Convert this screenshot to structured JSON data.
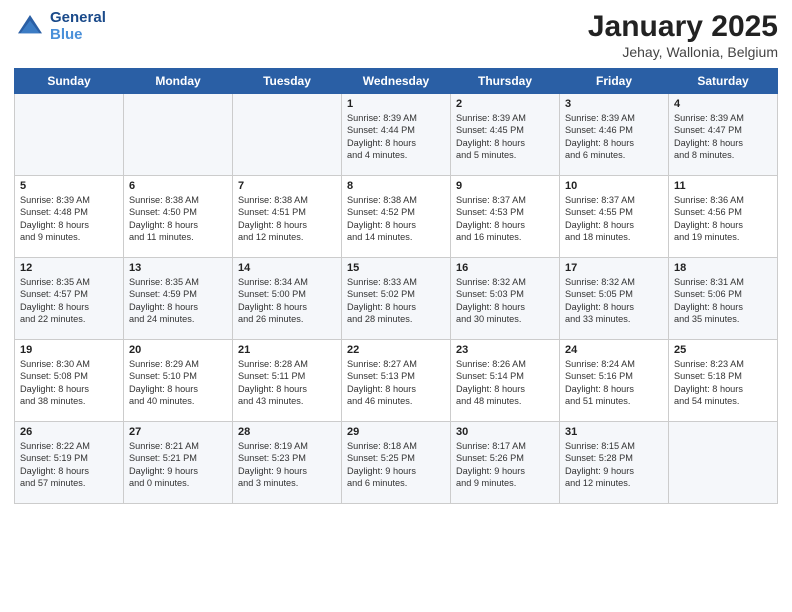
{
  "header": {
    "logo_line1": "General",
    "logo_line2": "Blue",
    "title": "January 2025",
    "subtitle": "Jehay, Wallonia, Belgium"
  },
  "days_of_week": [
    "Sunday",
    "Monday",
    "Tuesday",
    "Wednesday",
    "Thursday",
    "Friday",
    "Saturday"
  ],
  "weeks": [
    [
      {
        "day": "",
        "content": ""
      },
      {
        "day": "",
        "content": ""
      },
      {
        "day": "",
        "content": ""
      },
      {
        "day": "1",
        "content": "Sunrise: 8:39 AM\nSunset: 4:44 PM\nDaylight: 8 hours\nand 4 minutes."
      },
      {
        "day": "2",
        "content": "Sunrise: 8:39 AM\nSunset: 4:45 PM\nDaylight: 8 hours\nand 5 minutes."
      },
      {
        "day": "3",
        "content": "Sunrise: 8:39 AM\nSunset: 4:46 PM\nDaylight: 8 hours\nand 6 minutes."
      },
      {
        "day": "4",
        "content": "Sunrise: 8:39 AM\nSunset: 4:47 PM\nDaylight: 8 hours\nand 8 minutes."
      }
    ],
    [
      {
        "day": "5",
        "content": "Sunrise: 8:39 AM\nSunset: 4:48 PM\nDaylight: 8 hours\nand 9 minutes."
      },
      {
        "day": "6",
        "content": "Sunrise: 8:38 AM\nSunset: 4:50 PM\nDaylight: 8 hours\nand 11 minutes."
      },
      {
        "day": "7",
        "content": "Sunrise: 8:38 AM\nSunset: 4:51 PM\nDaylight: 8 hours\nand 12 minutes."
      },
      {
        "day": "8",
        "content": "Sunrise: 8:38 AM\nSunset: 4:52 PM\nDaylight: 8 hours\nand 14 minutes."
      },
      {
        "day": "9",
        "content": "Sunrise: 8:37 AM\nSunset: 4:53 PM\nDaylight: 8 hours\nand 16 minutes."
      },
      {
        "day": "10",
        "content": "Sunrise: 8:37 AM\nSunset: 4:55 PM\nDaylight: 8 hours\nand 18 minutes."
      },
      {
        "day": "11",
        "content": "Sunrise: 8:36 AM\nSunset: 4:56 PM\nDaylight: 8 hours\nand 19 minutes."
      }
    ],
    [
      {
        "day": "12",
        "content": "Sunrise: 8:35 AM\nSunset: 4:57 PM\nDaylight: 8 hours\nand 22 minutes."
      },
      {
        "day": "13",
        "content": "Sunrise: 8:35 AM\nSunset: 4:59 PM\nDaylight: 8 hours\nand 24 minutes."
      },
      {
        "day": "14",
        "content": "Sunrise: 8:34 AM\nSunset: 5:00 PM\nDaylight: 8 hours\nand 26 minutes."
      },
      {
        "day": "15",
        "content": "Sunrise: 8:33 AM\nSunset: 5:02 PM\nDaylight: 8 hours\nand 28 minutes."
      },
      {
        "day": "16",
        "content": "Sunrise: 8:32 AM\nSunset: 5:03 PM\nDaylight: 8 hours\nand 30 minutes."
      },
      {
        "day": "17",
        "content": "Sunrise: 8:32 AM\nSunset: 5:05 PM\nDaylight: 8 hours\nand 33 minutes."
      },
      {
        "day": "18",
        "content": "Sunrise: 8:31 AM\nSunset: 5:06 PM\nDaylight: 8 hours\nand 35 minutes."
      }
    ],
    [
      {
        "day": "19",
        "content": "Sunrise: 8:30 AM\nSunset: 5:08 PM\nDaylight: 8 hours\nand 38 minutes."
      },
      {
        "day": "20",
        "content": "Sunrise: 8:29 AM\nSunset: 5:10 PM\nDaylight: 8 hours\nand 40 minutes."
      },
      {
        "day": "21",
        "content": "Sunrise: 8:28 AM\nSunset: 5:11 PM\nDaylight: 8 hours\nand 43 minutes."
      },
      {
        "day": "22",
        "content": "Sunrise: 8:27 AM\nSunset: 5:13 PM\nDaylight: 8 hours\nand 46 minutes."
      },
      {
        "day": "23",
        "content": "Sunrise: 8:26 AM\nSunset: 5:14 PM\nDaylight: 8 hours\nand 48 minutes."
      },
      {
        "day": "24",
        "content": "Sunrise: 8:24 AM\nSunset: 5:16 PM\nDaylight: 8 hours\nand 51 minutes."
      },
      {
        "day": "25",
        "content": "Sunrise: 8:23 AM\nSunset: 5:18 PM\nDaylight: 8 hours\nand 54 minutes."
      }
    ],
    [
      {
        "day": "26",
        "content": "Sunrise: 8:22 AM\nSunset: 5:19 PM\nDaylight: 8 hours\nand 57 minutes."
      },
      {
        "day": "27",
        "content": "Sunrise: 8:21 AM\nSunset: 5:21 PM\nDaylight: 9 hours\nand 0 minutes."
      },
      {
        "day": "28",
        "content": "Sunrise: 8:19 AM\nSunset: 5:23 PM\nDaylight: 9 hours\nand 3 minutes."
      },
      {
        "day": "29",
        "content": "Sunrise: 8:18 AM\nSunset: 5:25 PM\nDaylight: 9 hours\nand 6 minutes."
      },
      {
        "day": "30",
        "content": "Sunrise: 8:17 AM\nSunset: 5:26 PM\nDaylight: 9 hours\nand 9 minutes."
      },
      {
        "day": "31",
        "content": "Sunrise: 8:15 AM\nSunset: 5:28 PM\nDaylight: 9 hours\nand 12 minutes."
      },
      {
        "day": "",
        "content": ""
      }
    ]
  ]
}
